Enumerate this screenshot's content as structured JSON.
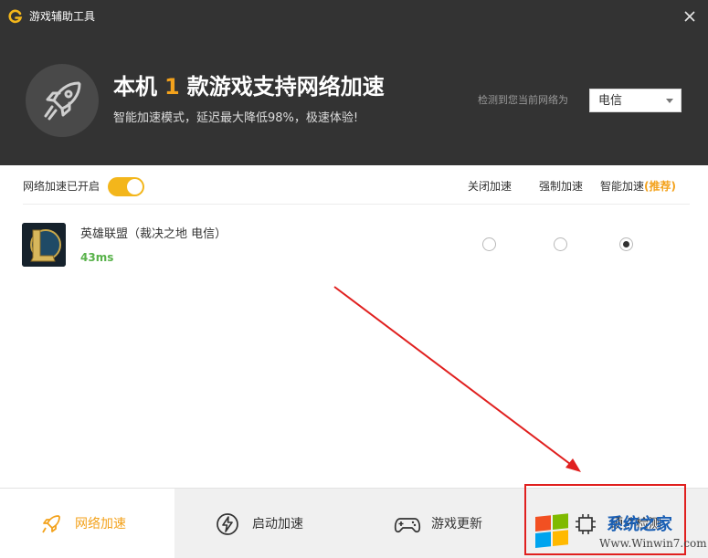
{
  "window": {
    "title": "游戏辅助工具",
    "close_icon": "close-icon",
    "logo_icon": "g-logo-icon",
    "logo_color": "#f3b61b"
  },
  "hero": {
    "title_pre": "本机",
    "count": "1",
    "title_post": "款游戏支持网络加速",
    "subtitle": "智能加速模式，延迟最大降低98%，极速体验!",
    "icon": "rocket-icon"
  },
  "network": {
    "label": "检测到您当前网络为",
    "selected": "电信"
  },
  "acceleration": {
    "label": "网络加速已开启",
    "enabled": true,
    "columns": {
      "off": "关闭加速",
      "force": "强制加速",
      "smart": "智能加速",
      "smart_note": "(推荐)"
    }
  },
  "games": [
    {
      "name": "英雄联盟（裁决之地 电信）",
      "ping": "43ms",
      "icon": "league-of-legends-icon",
      "mode": "smart"
    }
  ],
  "bottom_tabs": [
    {
      "label": "网络加速",
      "icon": "rocket-icon",
      "active": true
    },
    {
      "label": "启动加速",
      "icon": "lightning-icon",
      "active": false
    },
    {
      "label": "游戏更新",
      "icon": "gamepad-icon",
      "active": false
    },
    {
      "label": "硬件检测",
      "icon": "chip-icon",
      "active": false
    }
  ],
  "watermark": {
    "site": "系统之家",
    "url": "Www.Winwin7.com"
  },
  "colors": {
    "accent": "#f3a21c",
    "header_bg": "#333333",
    "ping_green": "#58b24a",
    "annotation_red": "#e0201f"
  }
}
